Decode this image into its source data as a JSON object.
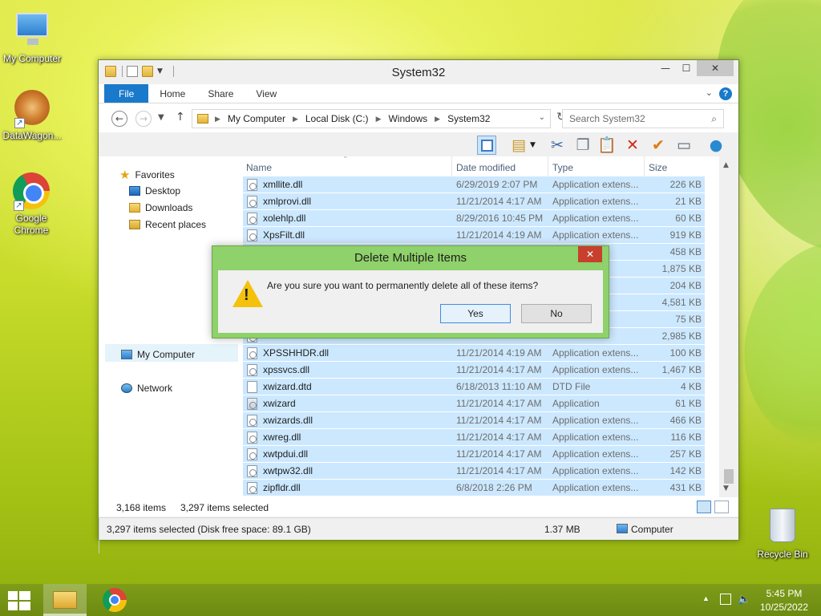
{
  "desktop": {
    "icons": [
      {
        "label": "My Computer"
      },
      {
        "label": "DataWagon..."
      },
      {
        "label": "Google Chrome"
      },
      {
        "label": "Recycle Bin"
      }
    ]
  },
  "window": {
    "title": "System32",
    "ribbon_tabs": [
      "File",
      "Home",
      "Share",
      "View"
    ],
    "help_icon": "?",
    "address": {
      "crumbs": [
        "My Computer",
        "Local Disk (C:)",
        "Windows",
        "System32"
      ]
    },
    "search": {
      "placeholder": "Search System32"
    },
    "navpane": {
      "favorites": "Favorites",
      "desktop": "Desktop",
      "downloads": "Downloads",
      "recent": "Recent places",
      "my_computer": "My Computer",
      "network": "Network"
    },
    "columns": {
      "name": "Name",
      "date": "Date modified",
      "type": "Type",
      "size": "Size"
    },
    "files": [
      {
        "name": "xmllite.dll",
        "date": "6/29/2019 2:07 PM",
        "type": "Application extens...",
        "size": "226 KB",
        "icon": "dll"
      },
      {
        "name": "xmlprovi.dll",
        "date": "11/21/2014 4:17 AM",
        "type": "Application extens...",
        "size": "21 KB",
        "icon": "dll"
      },
      {
        "name": "xolehlp.dll",
        "date": "8/29/2016 10:45 PM",
        "type": "Application extens...",
        "size": "60 KB",
        "icon": "dll"
      },
      {
        "name": "XpsFilt.dll",
        "date": "11/21/2014 4:19 AM",
        "type": "Application extens...",
        "size": "919 KB",
        "icon": "dll"
      },
      {
        "name": "",
        "date": "",
        "type": "",
        "size": "458 KB",
        "icon": "dll"
      },
      {
        "name": "",
        "date": "",
        "type": "",
        "size": "1,875 KB",
        "icon": "dll"
      },
      {
        "name": "",
        "date": "",
        "type": "",
        "size": "204 KB",
        "icon": "dll"
      },
      {
        "name": "",
        "date": "",
        "type": "",
        "size": "4,581 KB",
        "icon": "dll"
      },
      {
        "name": "",
        "date": "",
        "type": "nt",
        "size": "75 KB",
        "icon": "dll"
      },
      {
        "name": "",
        "date": "",
        "type": "",
        "size": "2,985 KB",
        "icon": "dll"
      },
      {
        "name": "XPSSHHDR.dll",
        "date": "11/21/2014 4:19 AM",
        "type": "Application extens...",
        "size": "100 KB",
        "icon": "dll"
      },
      {
        "name": "xpssvcs.dll",
        "date": "11/21/2014 4:17 AM",
        "type": "Application extens...",
        "size": "1,467 KB",
        "icon": "dll"
      },
      {
        "name": "xwizard.dtd",
        "date": "6/18/2013 11:10 AM",
        "type": "DTD File",
        "size": "4 KB",
        "icon": "file"
      },
      {
        "name": "xwizard",
        "date": "11/21/2014 4:17 AM",
        "type": "Application",
        "size": "61 KB",
        "icon": "app"
      },
      {
        "name": "xwizards.dll",
        "date": "11/21/2014 4:17 AM",
        "type": "Application extens...",
        "size": "466 KB",
        "icon": "dll"
      },
      {
        "name": "xwreg.dll",
        "date": "11/21/2014 4:17 AM",
        "type": "Application extens...",
        "size": "116 KB",
        "icon": "dll"
      },
      {
        "name": "xwtpdui.dll",
        "date": "11/21/2014 4:17 AM",
        "type": "Application extens...",
        "size": "257 KB",
        "icon": "dll"
      },
      {
        "name": "xwtpw32.dll",
        "date": "11/21/2014 4:17 AM",
        "type": "Application extens...",
        "size": "142 KB",
        "icon": "dll"
      },
      {
        "name": "zipfldr.dll",
        "date": "6/8/2018 2:26 PM",
        "type": "Application extens...",
        "size": "431 KB",
        "icon": "dll"
      }
    ],
    "status": {
      "items_count": "3,168 items",
      "selected_count": "3,297 items selected",
      "bar_selected": "3,297 items selected (Disk free space: 89.1 GB)",
      "bar_size": "1.37 MB",
      "bar_location": "Computer"
    }
  },
  "dialog": {
    "title": "Delete Multiple Items",
    "message": "Are you sure you want to permanently delete all of these items?",
    "yes": "Yes",
    "no": "No"
  },
  "taskbar": {
    "time": "5:45 PM",
    "date": "10/25/2022"
  }
}
